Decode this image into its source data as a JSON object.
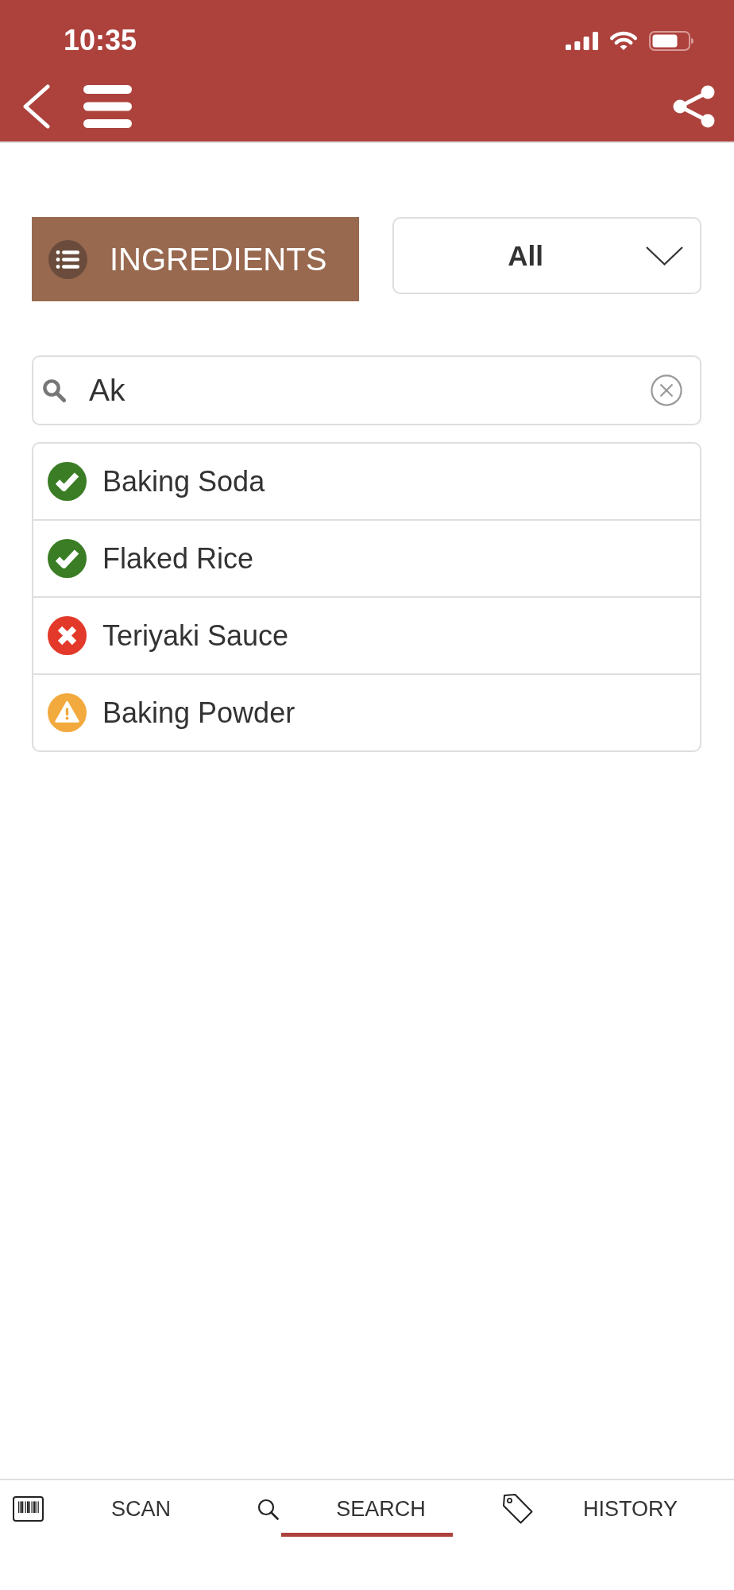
{
  "status_bar": {
    "time": "10:35"
  },
  "filter": {
    "category_button": {
      "label": "INGREDIENTS"
    },
    "dropdown": {
      "value": "All"
    }
  },
  "search": {
    "value": "Ak"
  },
  "results": [
    {
      "name": "Baking Soda",
      "kind": "safe"
    },
    {
      "name": "Flaked Rice",
      "kind": "safe"
    },
    {
      "name": "Teriyaki Sauce",
      "kind": "unsafe"
    },
    {
      "name": "Baking Powder",
      "kind": "caution"
    }
  ],
  "tab_bar": {
    "tabs": [
      {
        "label": "SCAN",
        "selected": false
      },
      {
        "label": "SEARCH",
        "selected": true
      },
      {
        "label": "HISTORY",
        "selected": false
      }
    ]
  }
}
